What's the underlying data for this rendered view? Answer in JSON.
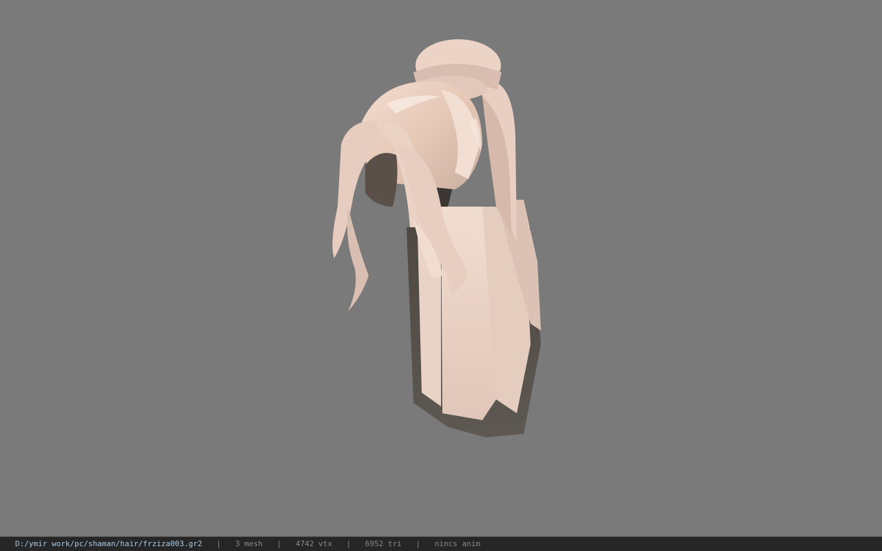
{
  "viewport": {
    "background_color": "#7a7a7a",
    "model_description_icon": "hair-mesh-model"
  },
  "statusbar": {
    "file_path": "D:/ymir work/pc/shaman/hair/frziza003.gr2",
    "separator": "|",
    "mesh_count": "3 mesh",
    "vertex_count": "4742 vtx",
    "triangle_count": "6952 tri",
    "anim_status": "nincs anim",
    "path_color": "#a9c8e0",
    "text_color": "#8a8a8a",
    "background_color": "#262626"
  }
}
